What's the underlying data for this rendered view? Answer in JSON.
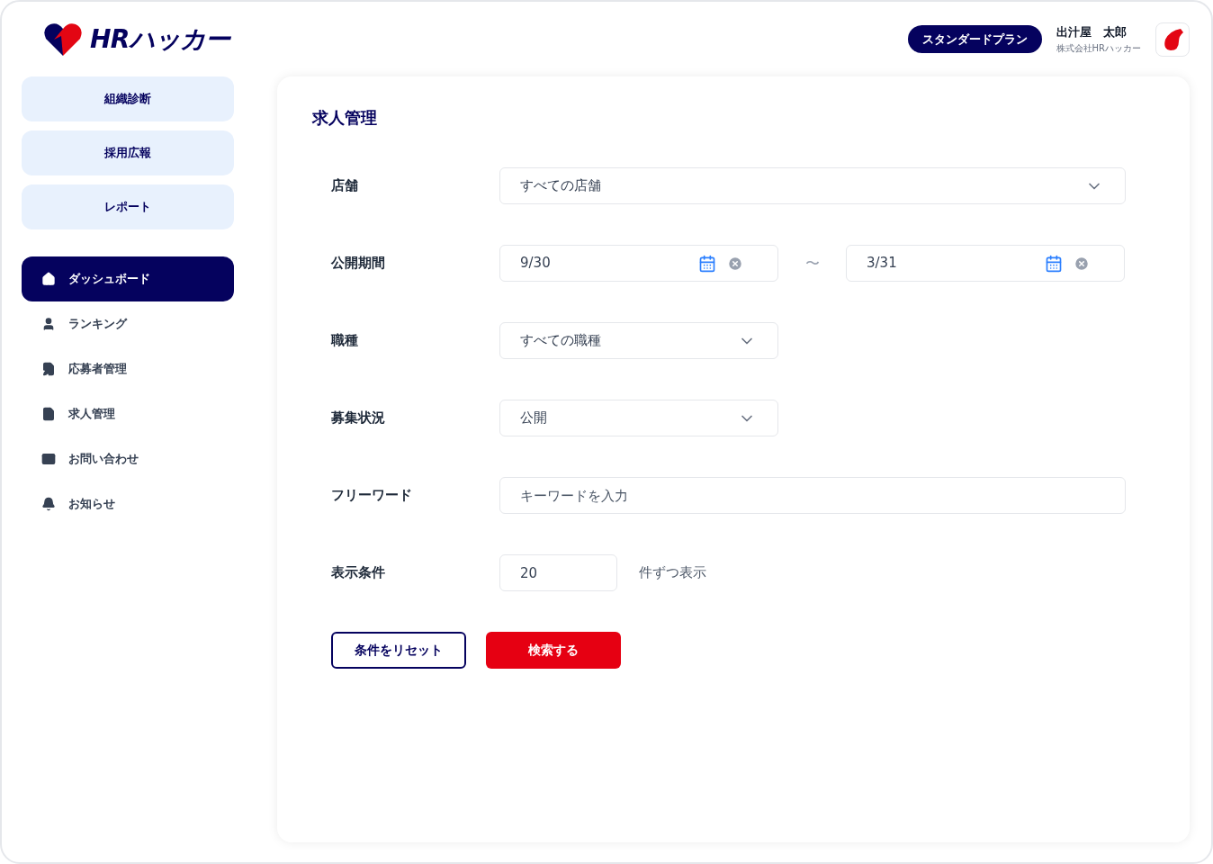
{
  "logo": {
    "text": "HRハッカー"
  },
  "header": {
    "plan": "スタンダードプラン",
    "user_name": "出汁屋　太郎",
    "company": "株式会社HRハッカー"
  },
  "sidebar": {
    "shortcuts": [
      "組織診断",
      "採用広報",
      "レポート"
    ],
    "nav": [
      {
        "label": "ダッシュボード",
        "selected": true
      },
      {
        "label": "ランキング",
        "selected": false
      },
      {
        "label": "応募者管理",
        "selected": false
      },
      {
        "label": "求人管理",
        "selected": false
      },
      {
        "label": "お問い合わせ",
        "selected": false
      },
      {
        "label": "お知らせ",
        "selected": false
      }
    ]
  },
  "form": {
    "title": "求人管理",
    "rows": [
      {
        "kind": "select",
        "label": "店舗",
        "value": "すべての店舗"
      },
      {
        "kind": "daterange",
        "label": "公開期間",
        "from": "9/30",
        "separator": "〜",
        "to": "3/31"
      },
      {
        "kind": "select",
        "label": "職種",
        "value": "すべての職種"
      },
      {
        "kind": "select",
        "label": "募集状況",
        "value": "公開"
      },
      {
        "kind": "text",
        "label": "フリーワード",
        "placeholder": "キーワードを入力"
      },
      {
        "kind": "number",
        "label": "表示条件",
        "value": "20",
        "suffix": "件ずつ表示"
      }
    ],
    "reset_button": "条件をリセット",
    "search_button": "検索する"
  }
}
